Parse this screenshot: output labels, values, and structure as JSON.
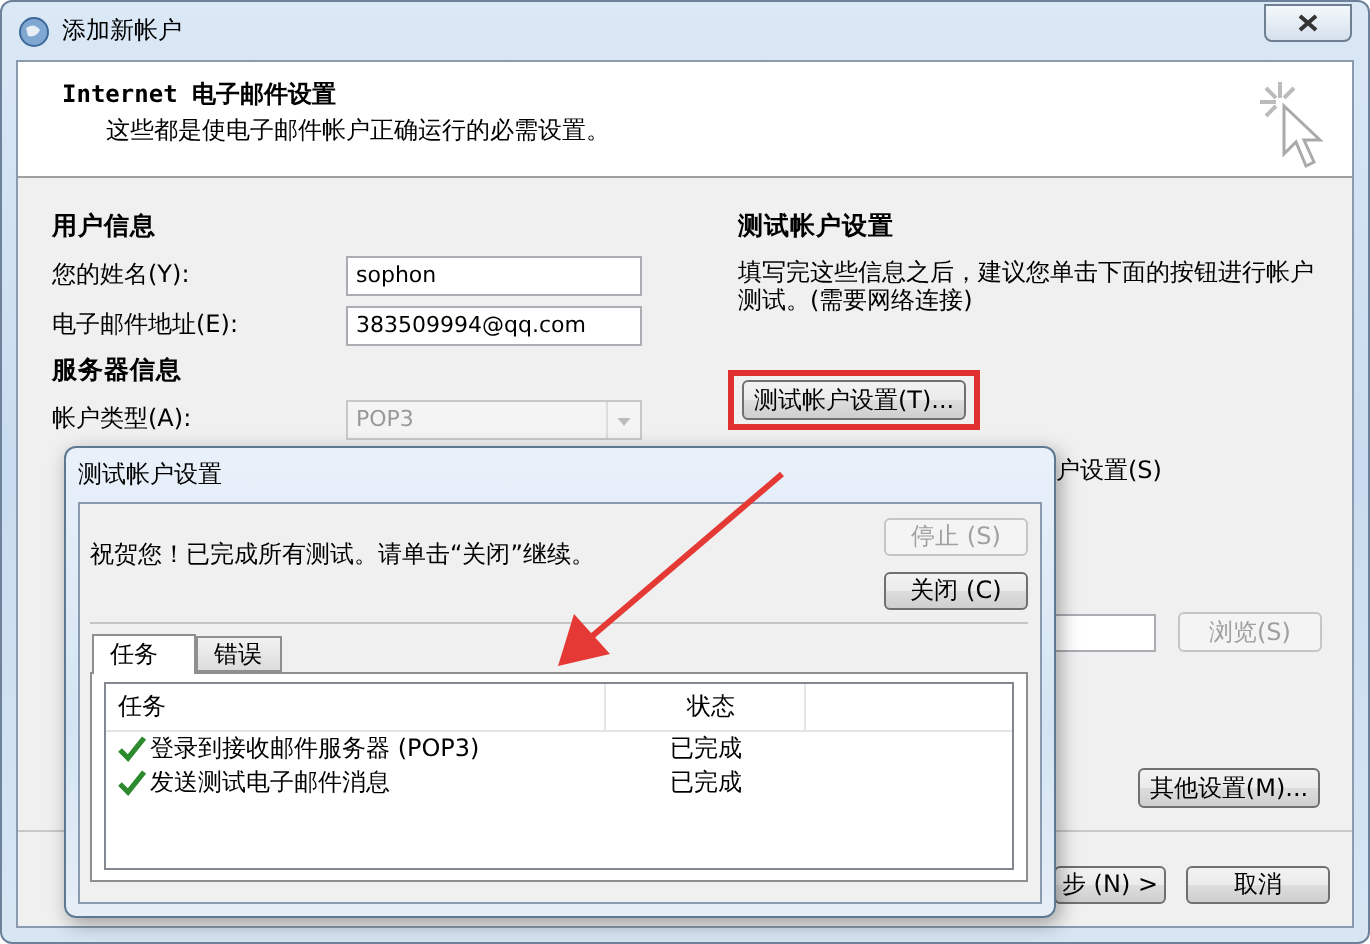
{
  "window": {
    "title": "添加新帐户"
  },
  "header": {
    "title": "Internet 电子邮件设置",
    "subtitle": "这些都是使电子邮件帐户正确运行的必需设置。"
  },
  "user_info": {
    "heading": "用户信息",
    "fields": [
      {
        "label": "您的姓名(Y):",
        "value": "sophon"
      },
      {
        "label": "电子邮件地址(E):",
        "value": "383509994@qq.com"
      }
    ]
  },
  "server_info": {
    "heading": "服务器信息",
    "account_type": {
      "label": "帐户类型(A):",
      "value": "POP3",
      "disabled": true
    }
  },
  "test_settings": {
    "heading": "测试帐户设置",
    "description": "填写完这些信息之后，建议您单击下面的按钮进行帐户测试。(需要网络连接)",
    "button": "测试帐户设置(T)...",
    "partial_option": "户设置(S)",
    "browse_button": {
      "label": "浏览(S)",
      "disabled": true
    }
  },
  "more_settings_button": "其他设置(M)...",
  "footer_buttons": [
    {
      "label": "步 (N) >"
    },
    {
      "label": "取消"
    }
  ],
  "dialog": {
    "title": "测试帐户设置",
    "message": "祝贺您！已完成所有测试。请单击“关闭”继续。",
    "buttons": [
      {
        "label": "停止 (S)",
        "disabled": true
      },
      {
        "label": "关闭 (C)",
        "disabled": false
      }
    ],
    "tabs": [
      {
        "label": "任务",
        "selected": true
      },
      {
        "label": "错误",
        "selected": false
      }
    ],
    "table": {
      "columns": [
        "任务",
        "状态"
      ],
      "rows": [
        {
          "task": "登录到接收邮件服务器 (POP3)",
          "status": "已完成",
          "done": true
        },
        {
          "task": "发送测试电子邮件消息",
          "status": "已完成",
          "done": true
        }
      ]
    }
  }
}
